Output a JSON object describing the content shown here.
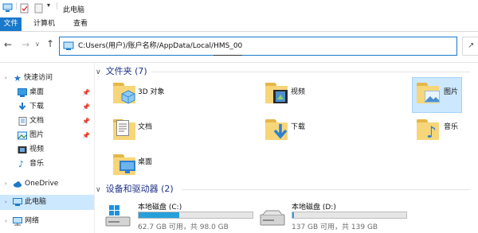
{
  "window": {
    "title": "此电脑"
  },
  "ribbon": {
    "tabs": [
      "文件",
      "计算机",
      "查看"
    ]
  },
  "address": {
    "path": "C:Users(用户)/账户名称/AppData/Local/",
    "path_tail": "HMS_00"
  },
  "sidebar": {
    "items": [
      {
        "label": "快速访问",
        "icon": "star-icon"
      },
      {
        "label": "桌面",
        "icon": "desktop-icon",
        "pinned": true
      },
      {
        "label": "下载",
        "icon": "download-icon",
        "pinned": true
      },
      {
        "label": "文档",
        "icon": "document-icon",
        "pinned": true
      },
      {
        "label": "图片",
        "icon": "picture-icon",
        "pinned": true
      },
      {
        "label": "视频",
        "icon": "video-icon"
      },
      {
        "label": "音乐",
        "icon": "music-icon"
      },
      {
        "label": "OneDrive",
        "icon": "cloud-icon"
      },
      {
        "label": "此电脑",
        "icon": "computer-icon",
        "selected": true
      },
      {
        "label": "网络",
        "icon": "network-icon"
      }
    ]
  },
  "folders_group": {
    "title": "文件夹 (7)"
  },
  "folders": [
    {
      "label": "3D 对象",
      "icon": "3d-objects-folder-icon"
    },
    {
      "label": "视频",
      "icon": "video-folder-icon"
    },
    {
      "label": "图片",
      "icon": "picture-folder-icon",
      "selected": true
    },
    {
      "label": "文档",
      "icon": "document-folder-icon"
    },
    {
      "label": "下载",
      "icon": "download-folder-icon"
    },
    {
      "label": "音乐",
      "icon": "music-folder-icon"
    },
    {
      "label": "桌面",
      "icon": "desktop-folder-icon"
    }
  ],
  "drives_group": {
    "title": "设备和驱动器 (2)"
  },
  "drives": [
    {
      "label": "本地磁盘 (C:)",
      "free_text": "62.7 GB 可用，共 98.0 GB",
      "used_fraction": 0.36
    },
    {
      "label": "本地磁盘 (D:)",
      "free_text": "137 GB 可用，共 139 GB",
      "used_fraction": 0.014
    }
  ],
  "colors": {
    "accent": "#1979ca",
    "folder": "#f7d679",
    "selection": "#cce8ff",
    "drive_fill": "#26a0da"
  }
}
